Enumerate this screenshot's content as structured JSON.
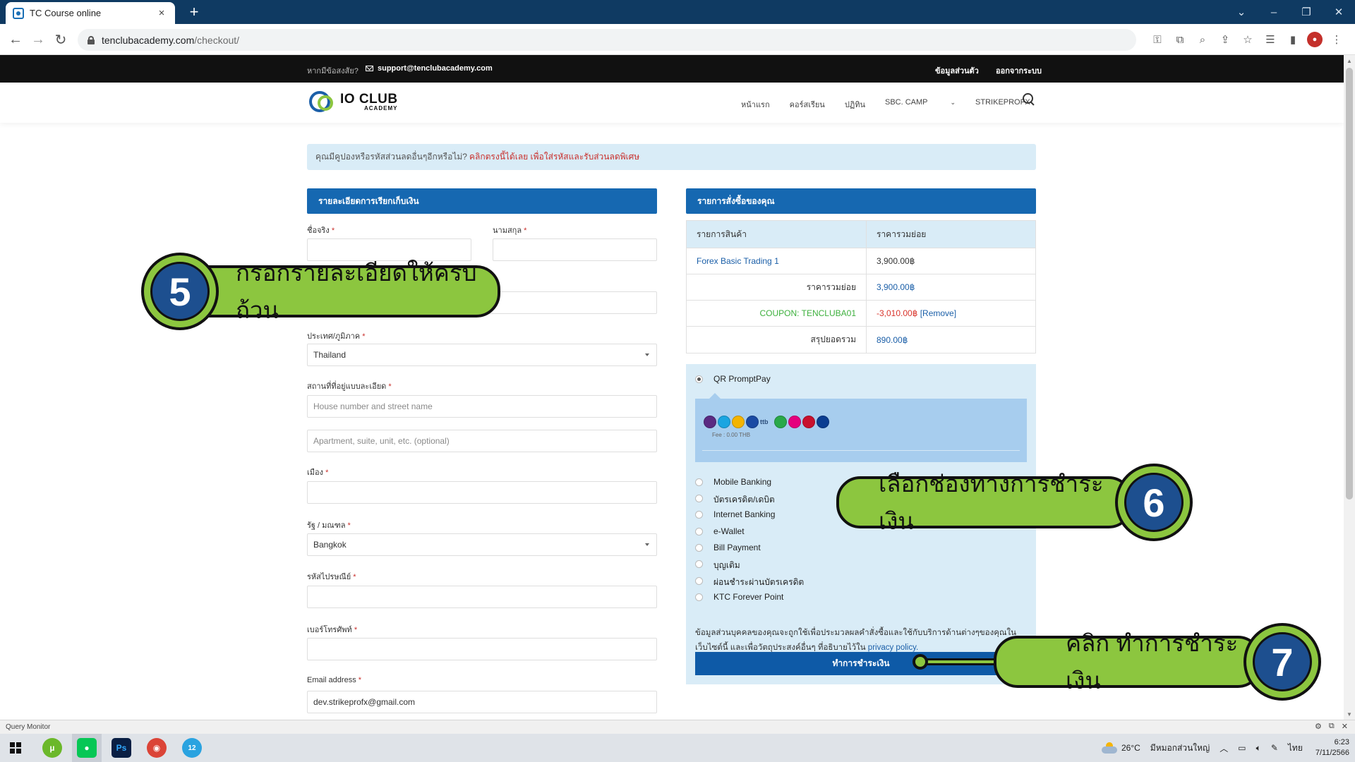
{
  "browser": {
    "tab_title": "TC Course online",
    "tab_close": "×",
    "new_tab": "+",
    "url_host": "tenclubacademy.com",
    "url_path": "/checkout/"
  },
  "topbar": {
    "help_text": "หากมีข้อสงสัย?",
    "email": "support@tenclubacademy.com",
    "account_link": "ข้อมูลส่วนตัว",
    "logout_link": "ออกจากระบบ"
  },
  "logo": {
    "title": "IO CLUB",
    "subtitle": "ACADEMY"
  },
  "nav": {
    "items": [
      "หน้าแรก",
      "คอร์สเรียน",
      "ปฏิทิน",
      "SBC. CAMP",
      "STRIKEPROFX"
    ],
    "dropdown_caret": "⌄"
  },
  "coupon_notice": {
    "text": "คุณมีคูปองหรือรหัสส่วนลดอื่นๆอีกหรือไม่?",
    "link": "คลิกตรงนี้ได้เลย เพื่อใส่รหัสและรับส่วนลดพิเศษ"
  },
  "billing": {
    "heading": "รายละเอียดการเรียกเก็บเงิน",
    "req_mark": "*",
    "first_name_label": "ชื่อจริง",
    "last_name_label": "นามสกุล",
    "first_name_value": "",
    "last_name_value": "",
    "country_label": "ประเทศ/ภูมิภาค",
    "country_value": "Thailand",
    "address_label": "สถานที่ที่อยู่แบบละเอียด",
    "address_placeholder": "House number and street name",
    "address2_placeholder": "Apartment, suite, unit, etc. (optional)",
    "city_label": "เมือง",
    "state_label": "รัฐ / มณฑล",
    "state_value": "Bangkok",
    "postcode_label": "รหัสไปรษณีย์",
    "phone_label": "เบอร์โทรศัพท์",
    "email_label": "Email address",
    "email_value": "dev.strikeprofx@gmail.com"
  },
  "order": {
    "heading": "รายการสั่งซื้อของคุณ",
    "col_product": "รายการสินค้า",
    "col_subtotal": "ราคารวมย่อย",
    "product_name": "Forex Basic Trading",
    "product_qty": "1",
    "product_price": "3,900.00฿",
    "subtotal_label": "ราคารวมย่อย",
    "subtotal_value": "3,900.00฿",
    "coupon_label": "COUPON: TENCLUBA01",
    "coupon_value": "-3,010.00฿",
    "coupon_remove": "[Remove]",
    "total_label": "สรุปยอดรวม",
    "total_value": "890.00฿"
  },
  "payment": {
    "selected": "QR PromptPay",
    "fee_text": "Fee : 0.00 THB",
    "bank_text_logo": "ttb",
    "methods": [
      "Mobile Banking",
      "บัตรเครดิต/เดบิต",
      "Internet Banking",
      "e-Wallet",
      "Bill Payment",
      "บุญเติม",
      "ผ่อนชำระผ่านบัตรเครดิต",
      "KTC Forever Point"
    ],
    "privacy_text": "ข้อมูลส่วนบุคคลของคุณจะถูกใช้เพื่อประมวลผลคำสั่งซื้อและใช้กับบริการด้านต่างๆของคุณในเว็บไซต์นี้ และเพื่อวัตถุประสงค์อื่นๆ ที่อธิบายไว้ใน",
    "privacy_link": "privacy policy.",
    "pay_button": "ทำการชำระเงิน"
  },
  "callouts": {
    "step5_number": "5",
    "step5_text": "กรอกรายละเอียดให้ครบถ้วน",
    "step6_number": "6",
    "step6_text": "เลือกช่องทางการชำระเงิน",
    "step7_number": "7",
    "step7_text": "คลิก ทำการชำระเงิน"
  },
  "query_monitor": {
    "label": "Query Monitor"
  },
  "taskbar": {
    "temperature": "26°C",
    "weather_text": "มีหมอกส่วนใหญ่",
    "lang": "ไทย",
    "time": "6:23",
    "date": "7/11/2566",
    "badge": "12",
    "ps_label": "Ps"
  },
  "colors": {
    "primary_blue": "#1668b1",
    "pay_button_blue": "#0e5aa7",
    "light_blue": "#d9ecf7",
    "callout_green": "#8cc63f",
    "callout_navy": "#1d4f8f",
    "coupon_green": "#3db03d",
    "discount_red": "#d9342b"
  }
}
